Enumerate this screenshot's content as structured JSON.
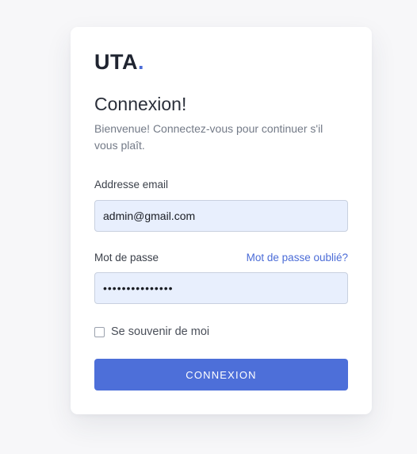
{
  "logo": {
    "text": "UTA",
    "dot": "."
  },
  "login": {
    "title": "Connexion!",
    "subtitle": "Bienvenue! Connectez-vous pour continuer s'il vous plaît.",
    "email_label": "Addresse email",
    "email_value": "admin@gmail.com",
    "password_label": "Mot de passe",
    "forgot_password": "Mot de passe oublié?",
    "password_value": "•••••••••••••••",
    "remember_label": "Se souvenir de moi",
    "remember_checked": false,
    "submit_label": "CONNEXION"
  },
  "colors": {
    "accent": "#4d6fd9",
    "input_bg": "#e8effd",
    "page_bg": "#f7f7f9"
  }
}
